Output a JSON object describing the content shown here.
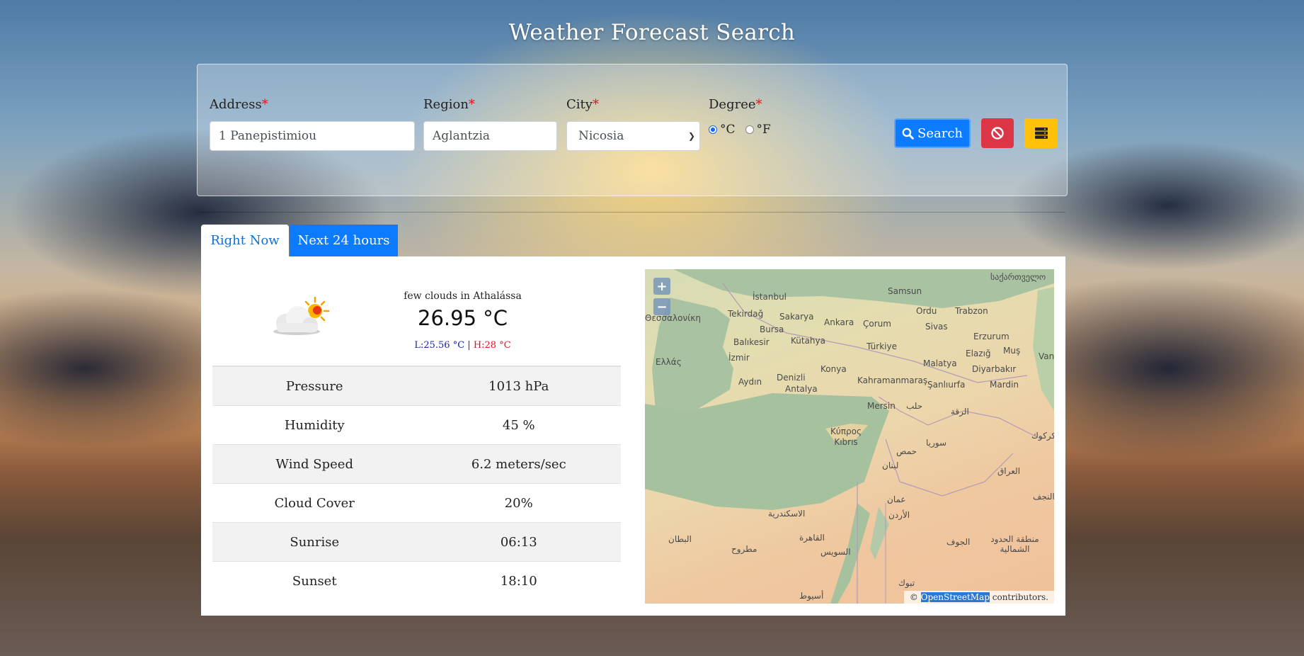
{
  "page": {
    "title": "Weather Forecast Search"
  },
  "search": {
    "address": {
      "label": "Address",
      "required": "*",
      "value": "1 Panepistimiou"
    },
    "region": {
      "label": "Region",
      "required": "*",
      "value": "Aglantzia"
    },
    "city": {
      "label": "City",
      "required": "*",
      "selected": "Nicosia"
    },
    "degree": {
      "label": "Degree",
      "required": "*",
      "celsius": "°C",
      "fahrenheit": "°F",
      "selected": "celsius"
    },
    "search_label": "Search",
    "search_icon": "search-icon",
    "clear_icon": "ban-icon",
    "history_icon": "database-icon"
  },
  "tabs": [
    {
      "label": "Right Now",
      "active": true
    },
    {
      "label": "Next 24 hours",
      "active": false
    }
  ],
  "current": {
    "icon": "few-clouds-icon",
    "description": "few clouds in Athalássa",
    "temperature": "26.95 °C",
    "low": "L:25.56 °C",
    "separator": "|",
    "high": "H:28 °C"
  },
  "stats": [
    {
      "label": "Pressure",
      "value": "1013 hPa"
    },
    {
      "label": "Humidity",
      "value": "45 %"
    },
    {
      "label": "Wind Speed",
      "value": "6.2 meters/sec"
    },
    {
      "label": "Cloud Cover",
      "value": "20%"
    },
    {
      "label": "Sunrise",
      "value": "06:13"
    },
    {
      "label": "Sunset",
      "value": "18:10"
    }
  ],
  "map": {
    "zoom_in": "+",
    "zoom_out": "−",
    "attribution_prefix": "©",
    "attribution_link": "OpenStreetMap",
    "attribution_suffix": " contributors.",
    "places": [
      "İstanbul",
      "Samsun",
      "Tekirdağ",
      "Sakarya",
      "Ankara",
      "Çorum",
      "Ordu",
      "Trabzon",
      "Θεσσαλονίκη",
      "Bursa",
      "Sivas",
      "Erzurum",
      "Balıkesir",
      "Kütahya",
      "Türkiye",
      "Ελλάς",
      "İzmir",
      "Konya",
      "Malatya",
      "Elazığ",
      "Muş",
      "Van",
      "Aydın",
      "Denizli",
      "Kahramanmaraş",
      "Diyarbakır",
      "Antalya",
      "Şanlıurfa",
      "Mardin",
      "Mersin",
      "حلب",
      "الرقة",
      "Κύπρος Kıbrıs",
      "سوريا",
      "حمص",
      "لبنان",
      "العراق",
      "الاسكندرية",
      "القاهرة",
      "عمان",
      "الأردن",
      "السويس",
      "مطروح",
      "البطان",
      "أسيوط",
      "تبوك",
      "الجوف",
      "منطقة الحدود الشمالية",
      "საქართველო",
      "كركوك",
      "النجف"
    ]
  },
  "colors": {
    "primary": "#0d7bff",
    "danger": "#dc3545",
    "warning": "#ffc107",
    "low_temp": "#1a22a8",
    "high_temp": "#e0121e"
  }
}
